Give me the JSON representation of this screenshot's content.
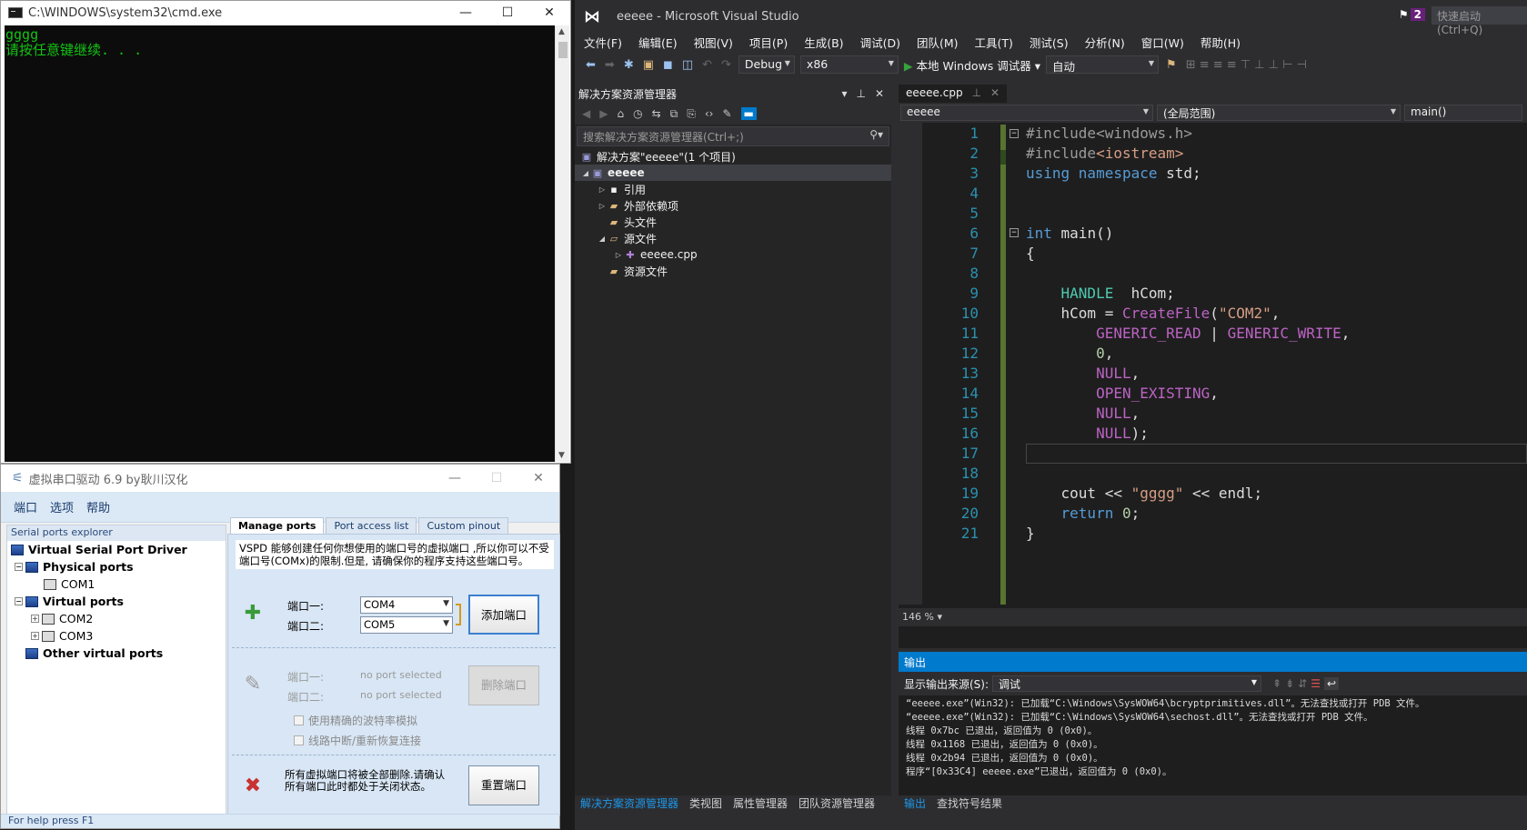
{
  "cmd": {
    "title": "C:\\WINDOWS\\system32\\cmd.exe",
    "lines": [
      "gggg",
      "请按任意键继续. . ."
    ]
  },
  "vspd": {
    "title": "虚拟串口驱动 6.9 by耿川汉化",
    "menu": [
      "端口",
      "选项",
      "帮助"
    ],
    "explorer_header": "Serial ports explorer",
    "tree": {
      "root": "Virtual Serial Port Driver",
      "physical": "Physical ports",
      "com1": "COM1",
      "virtual": "Virtual ports",
      "com2": "COM2",
      "com3": "COM3",
      "other": "Other virtual ports"
    },
    "tabs": [
      "Manage ports",
      "Port access list",
      "Custom pinout"
    ],
    "description": "VSPD 能够创建任何你想使用的端口号的虚拟端口 ,所以你可以不受端口号(COMx)的限制.但是, 请确保你的程序支持这些端口号。",
    "add": {
      "port1_label": "端口一:",
      "port2_label": "端口二:",
      "port1_value": "COM4",
      "port2_value": "COM5",
      "button": "添加端口"
    },
    "remove": {
      "port1_label": "端口一:",
      "port2_label": "端口二:",
      "port1_value": "no port selected",
      "port2_value": "no port selected",
      "button": "删除端口"
    },
    "options": {
      "baud": "使用精确的波特率模拟",
      "reconnect": "线路中断/重新恢复连接"
    },
    "reset": {
      "text": "所有虚拟端口将被全部删除.请确认所有端口此时都处于关闭状态。",
      "button": "重置端口"
    },
    "status": "For help press F1"
  },
  "vs": {
    "title": "eeeee - Microsoft Visual Studio",
    "notification_count": "2",
    "quick_launch": "快速启动 (Ctrl+Q)",
    "menu": [
      "文件(F)",
      "编辑(E)",
      "视图(V)",
      "项目(P)",
      "生成(B)",
      "调试(D)",
      "团队(M)",
      "工具(T)",
      "测试(S)",
      "分析(N)",
      "窗口(W)",
      "帮助(H)"
    ],
    "toolbar": {
      "config": "Debug",
      "platform": "x86",
      "run": "本地 Windows 调试器",
      "mode": "自动"
    },
    "solution_explorer": {
      "title": "解决方案资源管理器",
      "search_placeholder": "搜索解决方案资源管理器(Ctrl+;)",
      "solution": "解决方案\"eeeee\"(1 个项目)",
      "project": "eeeee",
      "nodes": [
        "引用",
        "外部依赖项",
        "头文件",
        "源文件",
        "eeeee.cpp",
        "资源文件"
      ],
      "bottom_tabs": [
        "解决方案资源管理器",
        "类视图",
        "属性管理器",
        "团队资源管理器"
      ]
    },
    "editor": {
      "tab": "eeeee.cpp",
      "nav_project": "eeeee",
      "nav_scope": "(全局范围)",
      "nav_func": "main()",
      "zoom": "146 %",
      "line_numbers": [
        "1",
        "2",
        "3",
        "4",
        "5",
        "6",
        "7",
        "8",
        "9",
        "10",
        "11",
        "12",
        "13",
        "14",
        "15",
        "16",
        "17",
        "18",
        "19",
        "20",
        "21"
      ]
    },
    "output": {
      "title": "输出",
      "source_label": "显示输出来源(S):",
      "source_value": "调试",
      "lines": [
        "“eeeee.exe”(Win32): 已加载“C:\\Windows\\SysWOW64\\bcryptprimitives.dll”。无法查找或打开 PDB 文件。",
        "“eeeee.exe”(Win32): 已加载“C:\\Windows\\SysWOW64\\sechost.dll”。无法查找或打开 PDB 文件。",
        "线程 0x7bc 已退出，返回值为 0 (0x0)。",
        "线程 0x1168 已退出，返回值为 0 (0x0)。",
        "线程 0x2b94 已退出，返回值为 0 (0x0)。",
        "程序“[0x33C4] eeeee.exe”已退出，返回值为 0 (0x0)。"
      ],
      "bottom_tabs": [
        "输出",
        "查找符号结果"
      ]
    }
  }
}
